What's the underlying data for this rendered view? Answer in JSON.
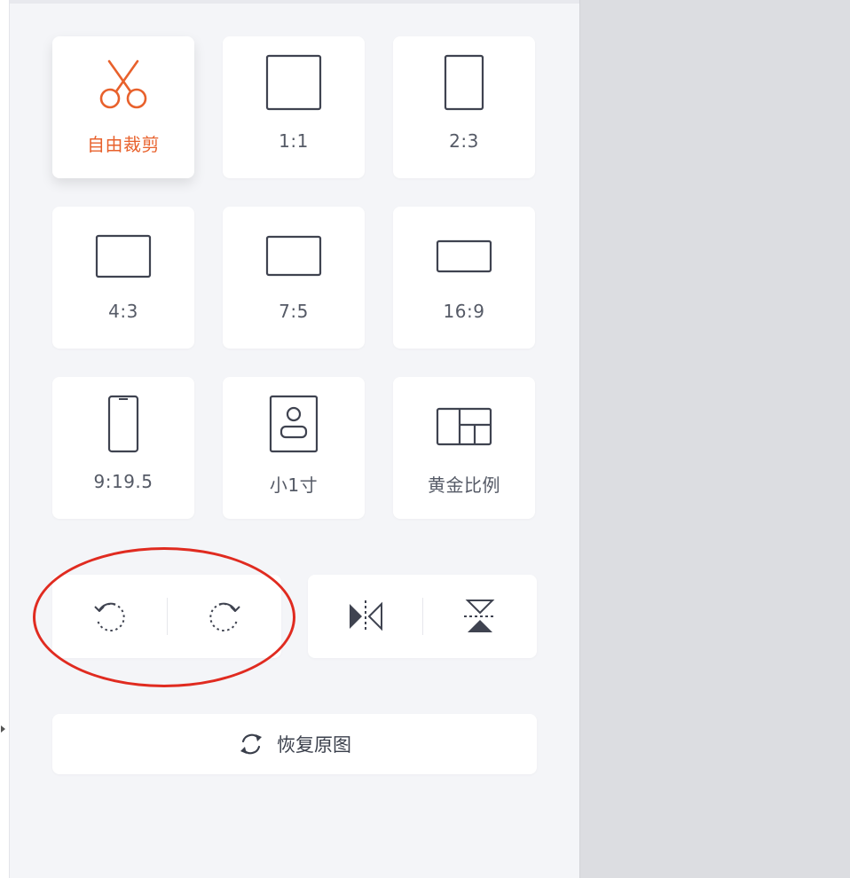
{
  "crop_panel": {
    "ratio_tiles": [
      {
        "label": "自由裁剪",
        "icon": "scissors-icon",
        "active": true
      },
      {
        "label": "1:1",
        "icon": "square-frame-icon",
        "active": false
      },
      {
        "label": "2:3",
        "icon": "portrait-frame-icon",
        "active": false
      },
      {
        "label": "4:3",
        "icon": "landscape-frame-icon",
        "active": false
      },
      {
        "label": "7:5",
        "icon": "landscape-frame-icon",
        "active": false
      },
      {
        "label": "16:9",
        "icon": "wide-frame-icon",
        "active": false
      },
      {
        "label": "9:19.5",
        "icon": "phone-icon",
        "active": false
      },
      {
        "label": "小1寸",
        "icon": "id-photo-icon",
        "active": false
      },
      {
        "label": "黄金比例",
        "icon": "golden-ratio-grid-icon",
        "active": false
      }
    ],
    "rotate_buttons": [
      {
        "icon": "rotate-left-icon"
      },
      {
        "icon": "rotate-right-icon"
      }
    ],
    "flip_buttons": [
      {
        "icon": "flip-horizontal-icon"
      },
      {
        "icon": "flip-vertical-icon"
      }
    ],
    "restore": {
      "label": "恢复原图",
      "icon": "refresh-icon"
    }
  },
  "colors": {
    "accent": "#e8612c",
    "annotation": "#e02b20",
    "icon_stroke": "#3f4350",
    "panel_bg": "#f4f5f8",
    "canvas_bg": "#dcdde1"
  }
}
